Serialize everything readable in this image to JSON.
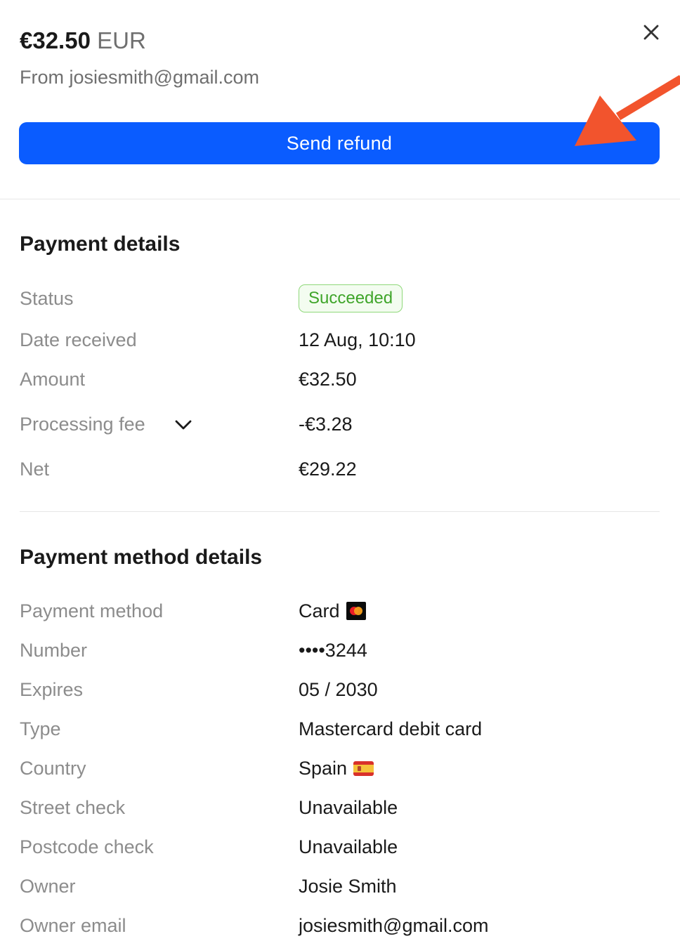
{
  "header": {
    "amount": "€32.50",
    "currency": "EUR",
    "from": "From josiesmith@gmail.com"
  },
  "actions": {
    "refund_label": "Send refund",
    "close_icon": "close-icon"
  },
  "colors": {
    "primary": "#0a5cff",
    "annotation_arrow": "#f2542d",
    "success": "#3fa52a"
  },
  "payment_details": {
    "title": "Payment details",
    "status_label": "Status",
    "status_value": "Succeeded",
    "date_label": "Date received",
    "date_value": "12 Aug, 10:10",
    "amount_label": "Amount",
    "amount_value": "€32.50",
    "fee_label": "Processing fee",
    "fee_value": "-€3.28",
    "net_label": "Net",
    "net_value": "€29.22"
  },
  "method_details": {
    "title": "Payment method details",
    "rows": [
      {
        "label": "Payment method",
        "value": "Card",
        "icon": "mastercard-icon"
      },
      {
        "label": "Number",
        "value": "••••3244"
      },
      {
        "label": "Expires",
        "value": "05 / 2030"
      },
      {
        "label": "Type",
        "value": "Mastercard debit card"
      },
      {
        "label": "Country",
        "value": "Spain",
        "icon": "spain-flag-icon"
      },
      {
        "label": "Street check",
        "value": "Unavailable"
      },
      {
        "label": "Postcode check",
        "value": "Unavailable"
      },
      {
        "label": "Owner",
        "value": "Josie Smith"
      },
      {
        "label": "Owner email",
        "value": "josiesmith@gmail.com"
      }
    ]
  }
}
